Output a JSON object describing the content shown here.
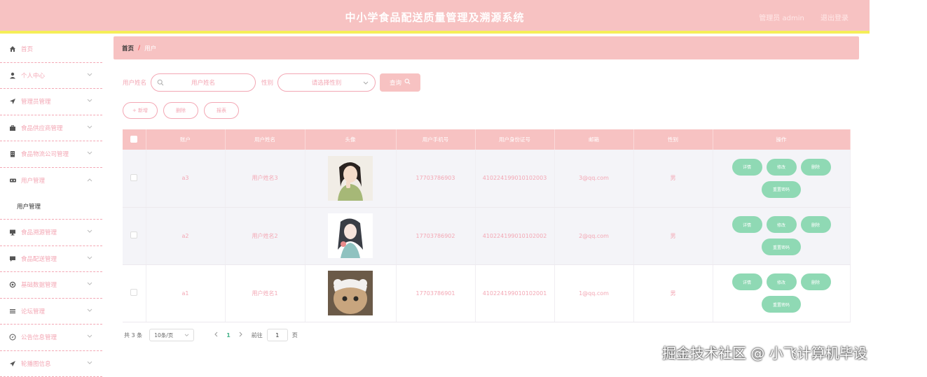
{
  "header": {
    "title": "中小学食品配送质量管理及溯源系统",
    "role_user": "管理员 admin",
    "logout": "退出登录"
  },
  "sidebar": {
    "items": [
      {
        "label": "首页",
        "icon": "home-icon"
      },
      {
        "label": "个人中心",
        "icon": "user-icon"
      },
      {
        "label": "管理员管理",
        "icon": "send-icon"
      },
      {
        "label": "食品供应商管理",
        "icon": "briefcase-icon"
      },
      {
        "label": "食品物流公司管理",
        "icon": "building-icon"
      },
      {
        "label": "用户管理",
        "icon": "vr-icon"
      },
      {
        "label": "食品溯源管理",
        "icon": "monitor-icon"
      },
      {
        "label": "食品配送管理",
        "icon": "chat-icon"
      },
      {
        "label": "基础数据管理",
        "icon": "settings-icon"
      },
      {
        "label": "论坛管理",
        "icon": "list-icon"
      },
      {
        "label": "公告信息管理",
        "icon": "compass-icon"
      },
      {
        "label": "轮播图信息",
        "icon": "plane-icon"
      }
    ],
    "submenu_label": "用户管理"
  },
  "breadcrumb": {
    "home": "首页",
    "sep": "/",
    "current": "用户"
  },
  "search": {
    "name_label": "用户姓名",
    "name_placeholder": "用户姓名",
    "gender_label": "性别",
    "gender_placeholder": "请选择性别",
    "button": "查询"
  },
  "actions": {
    "add": "+ 新增",
    "delete": "删除",
    "report": "报表"
  },
  "table": {
    "headers": [
      "账户",
      "用户姓名",
      "头像",
      "用户手机号",
      "用户身份证号",
      "邮箱",
      "性别",
      "操作"
    ],
    "rows": [
      {
        "account": "a3",
        "name": "用户姓名3",
        "phone": "17703786903",
        "idcard": "410224199010102003",
        "email": "3@qq.com",
        "gender": "男"
      },
      {
        "account": "a2",
        "name": "用户姓名2",
        "phone": "17703786902",
        "idcard": "410224199010102002",
        "email": "2@qq.com",
        "gender": "男"
      },
      {
        "account": "a1",
        "name": "用户姓名1",
        "phone": "17703786901",
        "idcard": "410224199010102001",
        "email": "1@qq.com",
        "gender": "男"
      }
    ],
    "ops": {
      "detail": "详情",
      "edit": "修改",
      "delete": "删除",
      "reset": "重置密码"
    }
  },
  "pager": {
    "total": "共 3 条",
    "page_size": "10条/页",
    "current": "1",
    "goto_prefix": "前往",
    "goto_value": "1",
    "goto_suffix": "页"
  },
  "watermark": "掘金技术社区 @ 小飞计算机毕设",
  "colors": {
    "header": "#f7c2c2",
    "accent_line": "#f5ee58",
    "pink_text": "#f3a7b4",
    "op_green": "#8fd9b4"
  }
}
